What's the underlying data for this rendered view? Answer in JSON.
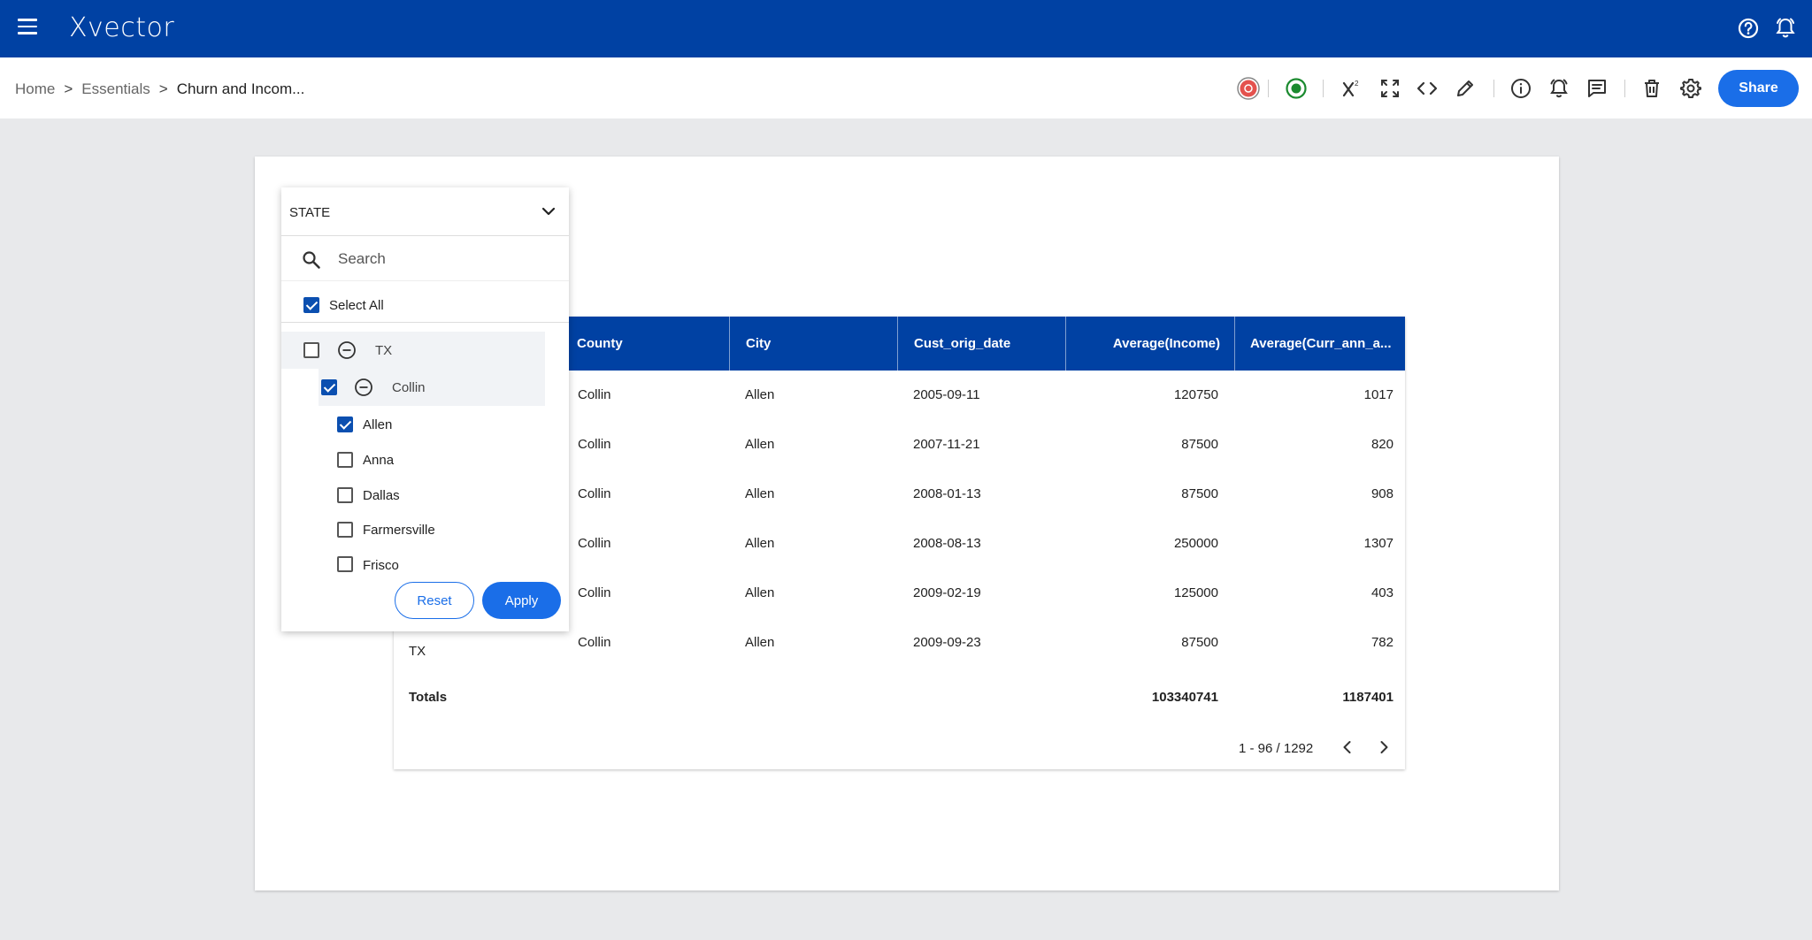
{
  "app": {
    "logo": "Xvector"
  },
  "breadcrumb": {
    "home": "Home",
    "sep1": ">",
    "essentials": "Essentials",
    "sep2": ">",
    "current": "Churn and Incom..."
  },
  "toolbar": {
    "share_label": "Share"
  },
  "table": {
    "headers": [
      "County",
      "City",
      "Cust_orig_date",
      "Average(Income)",
      "Average(Curr_ann_a..."
    ],
    "rows": [
      [
        "Collin",
        "Allen",
        "2005-09-11",
        "120750",
        "1017"
      ],
      [
        "Collin",
        "Allen",
        "2007-11-21",
        "87500",
        "820"
      ],
      [
        "Collin",
        "Allen",
        "2008-01-13",
        "87500",
        "908"
      ],
      [
        "Collin",
        "Allen",
        "2008-08-13",
        "250000",
        "1307"
      ],
      [
        "Collin",
        "Allen",
        "2009-02-19",
        "125000",
        "403"
      ],
      [
        "Collin",
        "Allen",
        "2009-09-23",
        "87500",
        "782"
      ]
    ],
    "last_row_state": "TX",
    "totals_label": "Totals",
    "totals_income": "103340741",
    "totals_curr": "1187401",
    "pager": "1 - 96 / 1292"
  },
  "filter": {
    "label": "STATE",
    "search_placeholder": "Search",
    "select_all": "Select All",
    "state": "TX",
    "county": "Collin",
    "cities": [
      "Allen",
      "Anna",
      "Dallas",
      "Farmersville",
      "Frisco"
    ],
    "reset_label": "Reset",
    "apply_label": "Apply"
  },
  "colors": {
    "topbar": "#0041a3",
    "accent": "#1a6ee8",
    "checkbox": "#0b4fb0"
  }
}
